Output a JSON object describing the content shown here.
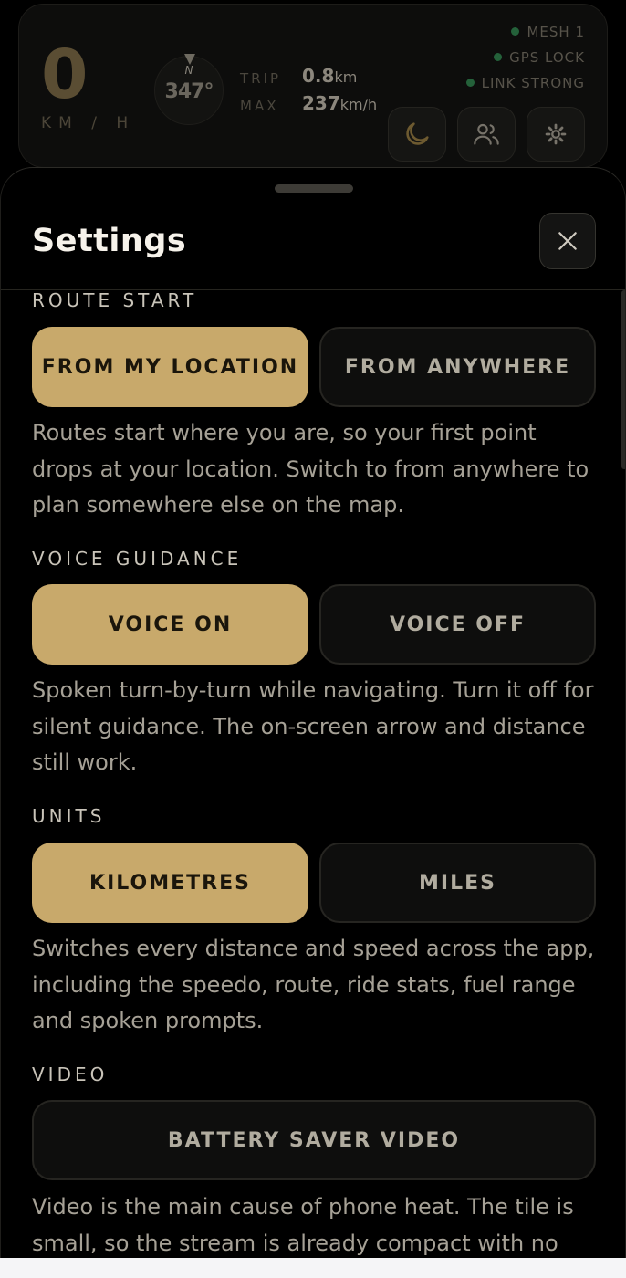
{
  "hud": {
    "speed": "0",
    "speed_unit": "KM / H",
    "compass": {
      "north": "N",
      "heading": "347°"
    },
    "trip": {
      "label": "TRIP",
      "value": "0.8",
      "unit": "km"
    },
    "max": {
      "label": "MAX",
      "value": "237",
      "unit": "km/h"
    },
    "status": [
      {
        "label": "MESH 1"
      },
      {
        "label": "GPS LOCK"
      },
      {
        "label": "LINK STRONG"
      }
    ],
    "buttons": {
      "night": "moon-icon",
      "group": "users-icon",
      "settings": "gear-icon"
    }
  },
  "settings": {
    "title": "Settings",
    "close_icon": "close-icon",
    "route_start": {
      "label": "ROUTE START",
      "option_a": "FROM MY LOCATION",
      "option_b": "FROM ANYWHERE",
      "selected": "option_a",
      "description": "Routes start where you are, so your first point drops at your location. Switch to from anywhere to plan somewhere else on the map."
    },
    "voice": {
      "label": "VOICE GUIDANCE",
      "option_a": "VOICE ON",
      "option_b": "VOICE OFF",
      "selected": "option_a",
      "description": "Spoken turn-by-turn while navigating. Turn it off for silent guidance. The on-screen arrow and distance still work."
    },
    "units": {
      "label": "UNITS",
      "option_a": "KILOMETRES",
      "option_b": "MILES",
      "selected": "option_a",
      "description": "Switches every distance and speed across the app, including the speedo, route, ride stats, fuel range and spoken prompts."
    },
    "video": {
      "label": "VIDEO",
      "option": "BATTERY SAVER VIDEO",
      "description": "Video is the main cause of phone heat. The tile is small, so the stream is already compact with no visible"
    }
  },
  "colors": {
    "accent": "#c8a96b",
    "status_dot": "#24613a",
    "background": "#000000"
  }
}
